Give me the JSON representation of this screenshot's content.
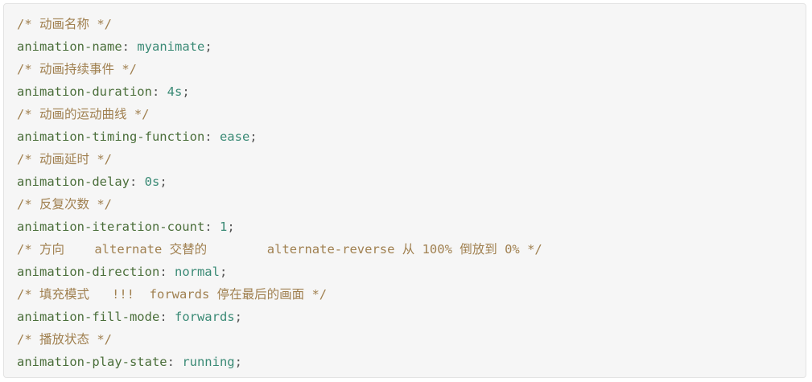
{
  "lines": [
    {
      "type": "comment",
      "text": "/* 动画名称 */"
    },
    {
      "type": "decl",
      "prop": "animation-name",
      "value": "myanimate"
    },
    {
      "type": "comment",
      "text": "/* 动画持续事件 */"
    },
    {
      "type": "decl",
      "prop": "animation-duration",
      "value": "4s"
    },
    {
      "type": "comment",
      "text": "/* 动画的运动曲线 */"
    },
    {
      "type": "decl",
      "prop": "animation-timing-function",
      "value": "ease"
    },
    {
      "type": "comment",
      "text": "/* 动画延时 */"
    },
    {
      "type": "decl",
      "prop": "animation-delay",
      "value": "0s"
    },
    {
      "type": "comment",
      "text": "/* 反复次数 */"
    },
    {
      "type": "decl",
      "prop": "animation-iteration-count",
      "value": "1"
    },
    {
      "type": "comment",
      "text": "/* 方向    alternate 交替的        alternate-reverse 从 100% 倒放到 0% */"
    },
    {
      "type": "decl",
      "prop": "animation-direction",
      "value": "normal"
    },
    {
      "type": "comment",
      "text": "/* 填充模式   !!!  forwards 停在最后的画面 */"
    },
    {
      "type": "decl",
      "prop": "animation-fill-mode",
      "value": "forwards"
    },
    {
      "type": "comment",
      "text": "/* 播放状态 */"
    },
    {
      "type": "decl",
      "prop": "animation-play-state",
      "value": "running"
    }
  ],
  "punct": {
    "colon": ": ",
    "semicolon": ";"
  },
  "colors": {
    "background": "#f6f6f6",
    "comment": "#a08050",
    "property": "#4a6e3a",
    "value": "#3a8a75"
  }
}
